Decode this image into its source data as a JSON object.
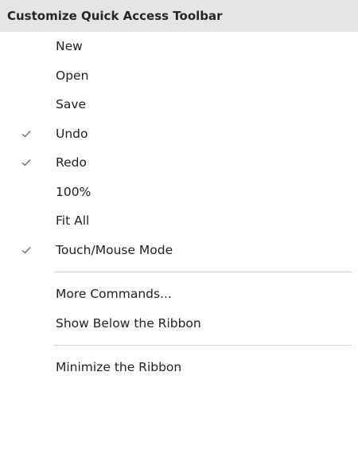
{
  "menu": {
    "title": "Customize Quick Access Toolbar",
    "items": [
      {
        "label": "New",
        "checked": false
      },
      {
        "label": "Open",
        "checked": false
      },
      {
        "label": "Save",
        "checked": false
      },
      {
        "label": "Undo",
        "checked": true
      },
      {
        "label": "Redo",
        "checked": true
      },
      {
        "label": "100%",
        "checked": false
      },
      {
        "label": "Fit All",
        "checked": false
      },
      {
        "label": "Touch/Mouse Mode",
        "checked": true
      }
    ],
    "more_commands": "More Commands...",
    "show_below_ribbon": "Show Below the Ribbon",
    "minimize_ribbon": "Minimize the Ribbon"
  },
  "icons": {
    "check": "check-icon"
  },
  "colors": {
    "header_bg": "#e5e5e5",
    "separator": "#d4d4d4",
    "check_mark": "#6e6e6e"
  }
}
